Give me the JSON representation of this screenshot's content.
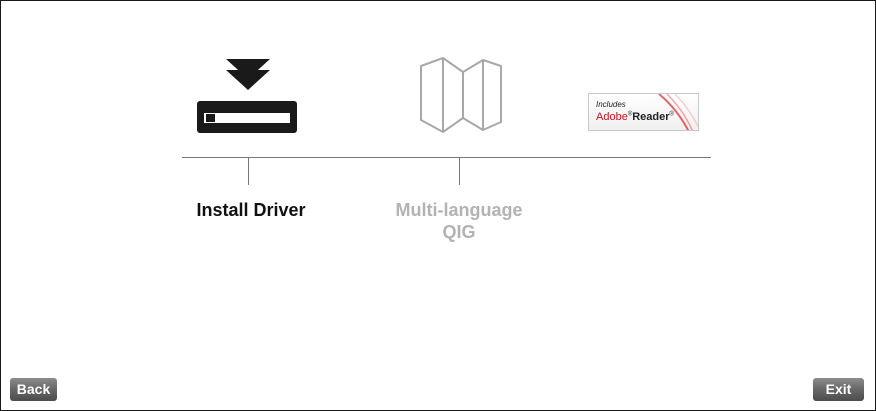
{
  "menu": {
    "items": [
      {
        "label": "Install Driver",
        "state": "active"
      },
      {
        "label_line1": "Multi-language",
        "label_line2": "QIG",
        "state": "disabled"
      }
    ]
  },
  "reader_badge": {
    "includes": "Includes",
    "brand": "Adobe",
    "product": "Reader",
    "trademark": "®"
  },
  "buttons": {
    "back": "Back",
    "exit": "Exit"
  },
  "colors": {
    "active_text": "#111111",
    "disabled_text": "#b3b3b3",
    "line": "#777777",
    "button_bg": "#666666",
    "adobe_red": "#c8141c"
  },
  "icons": {
    "install": "download-driver-icon",
    "qig": "folded-map-icon"
  }
}
